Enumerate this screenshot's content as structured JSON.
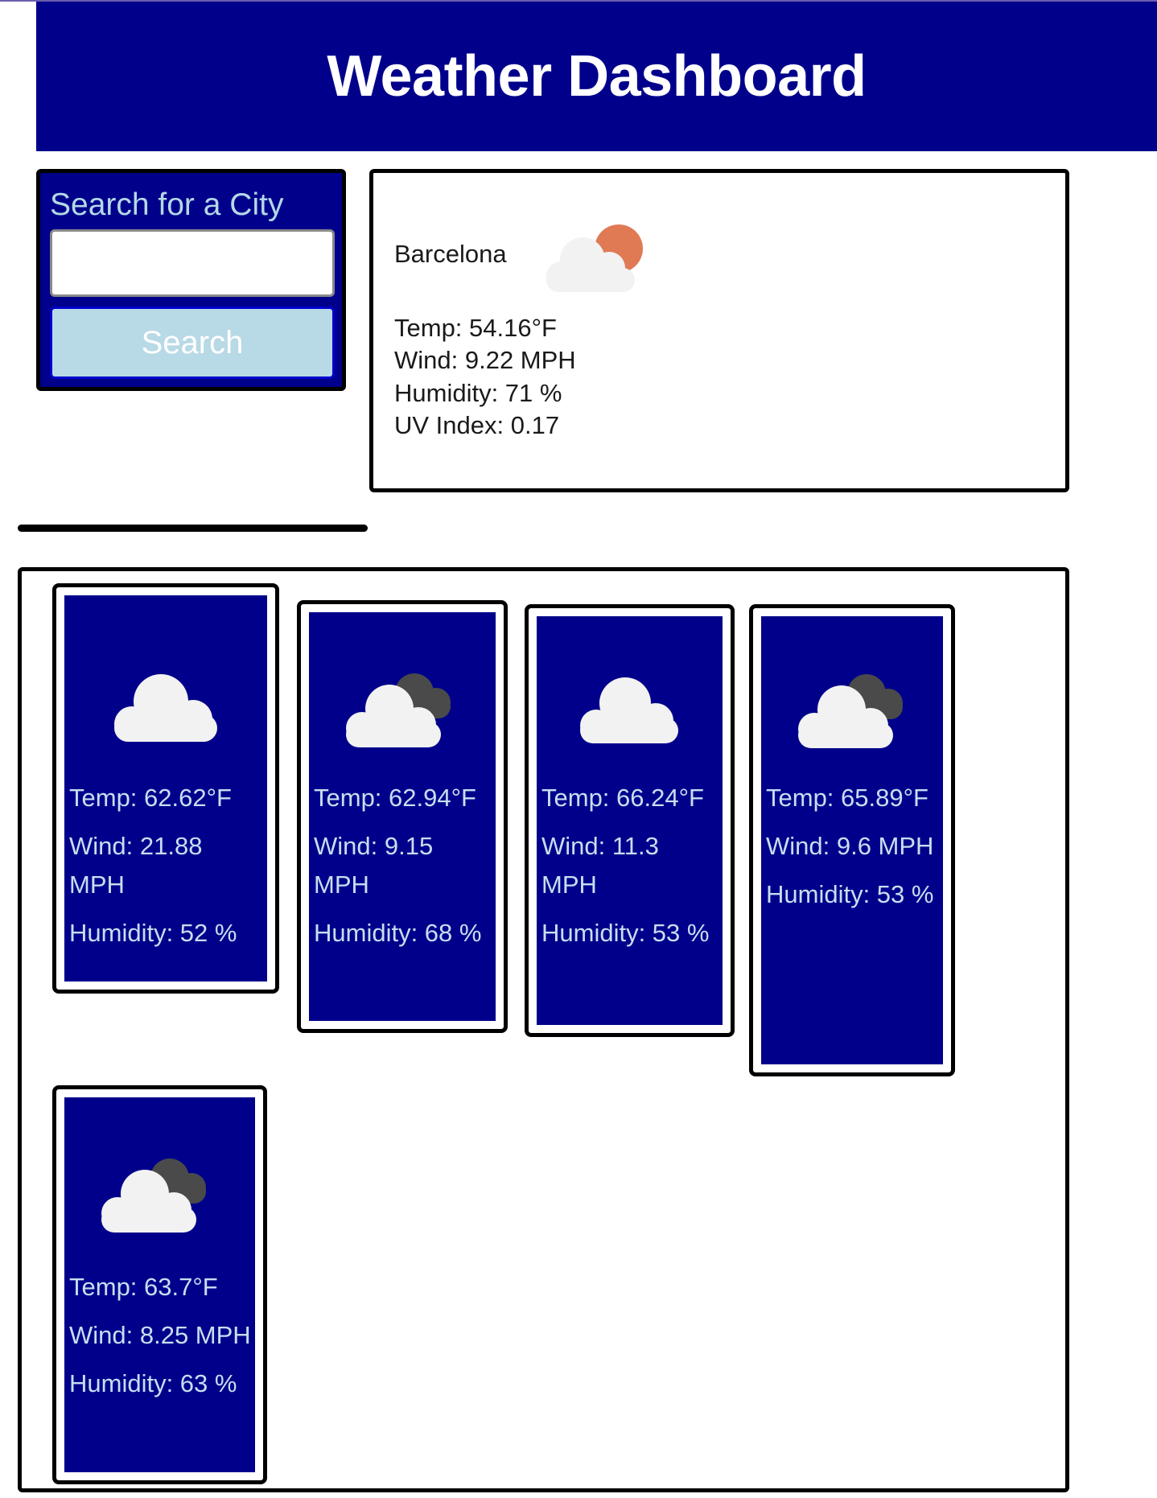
{
  "header": {
    "title": "Weather Dashboard"
  },
  "search": {
    "title": "Search for a City",
    "input_value": "",
    "placeholder": "",
    "button_label": "Search"
  },
  "current": {
    "city": "Barcelona",
    "icon": "partly-cloudy-sun-icon",
    "temp": "Temp: 54.16°F",
    "wind": "Wind: 9.22 MPH",
    "humidity": "Humidity: 71 %",
    "uv": "UV Index: 0.17"
  },
  "forecast": [
    {
      "icon": "cloud-icon",
      "temp": "Temp: 62.62°F",
      "wind": "Wind: 21.88 MPH",
      "humidity": "Humidity: 52 %"
    },
    {
      "icon": "broken-clouds-icon",
      "temp": "Temp: 62.94°F",
      "wind": "Wind: 9.15 MPH",
      "humidity": "Humidity: 68 %"
    },
    {
      "icon": "cloud-icon",
      "temp": "Temp: 66.24°F",
      "wind": "Wind: 11.3 MPH",
      "humidity": "Humidity: 53 %"
    },
    {
      "icon": "broken-clouds-icon",
      "temp": "Temp: 65.89°F",
      "wind": "Wind: 9.6 MPH",
      "humidity": "Humidity: 53 %"
    },
    {
      "icon": "broken-clouds-icon",
      "temp": "Temp: 63.7°F",
      "wind": "Wind: 8.25 MPH",
      "humidity": "Humidity: 63 %"
    }
  ],
  "colors": {
    "header_bg": "#00008b",
    "card_bg": "#00008b",
    "card_text": "#c6dff0",
    "button_bg": "#b8d9e6",
    "sun": "#e07a55"
  }
}
